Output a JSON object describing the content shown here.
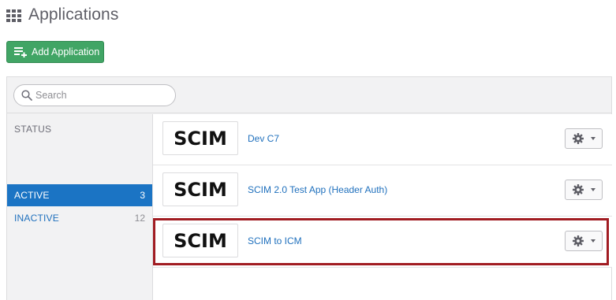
{
  "header": {
    "title": "Applications",
    "icon": "grid-icon"
  },
  "toolbar": {
    "add_label": "Add Application",
    "add_icon": "add-list-icon",
    "accent_color": "#41a565"
  },
  "search": {
    "placeholder": "Search",
    "value": ""
  },
  "sidebar": {
    "heading": "STATUS",
    "items": [
      {
        "label": "ACTIVE",
        "count": "3",
        "selected": true
      },
      {
        "label": "INACTIVE",
        "count": "12",
        "selected": false
      }
    ]
  },
  "apps": [
    {
      "logo": "SCIM",
      "name": "Dev C7",
      "action_icon": "gear-icon"
    },
    {
      "logo": "SCIM",
      "name": "SCIM 2.0 Test App (Header Auth)",
      "action_icon": "gear-icon"
    },
    {
      "logo": "SCIM",
      "name": "SCIM to ICM",
      "action_icon": "gear-icon"
    }
  ],
  "colors": {
    "selected_filter": "#1b74c4",
    "link": "#1f70bd",
    "highlight_border": "#a11c22"
  }
}
